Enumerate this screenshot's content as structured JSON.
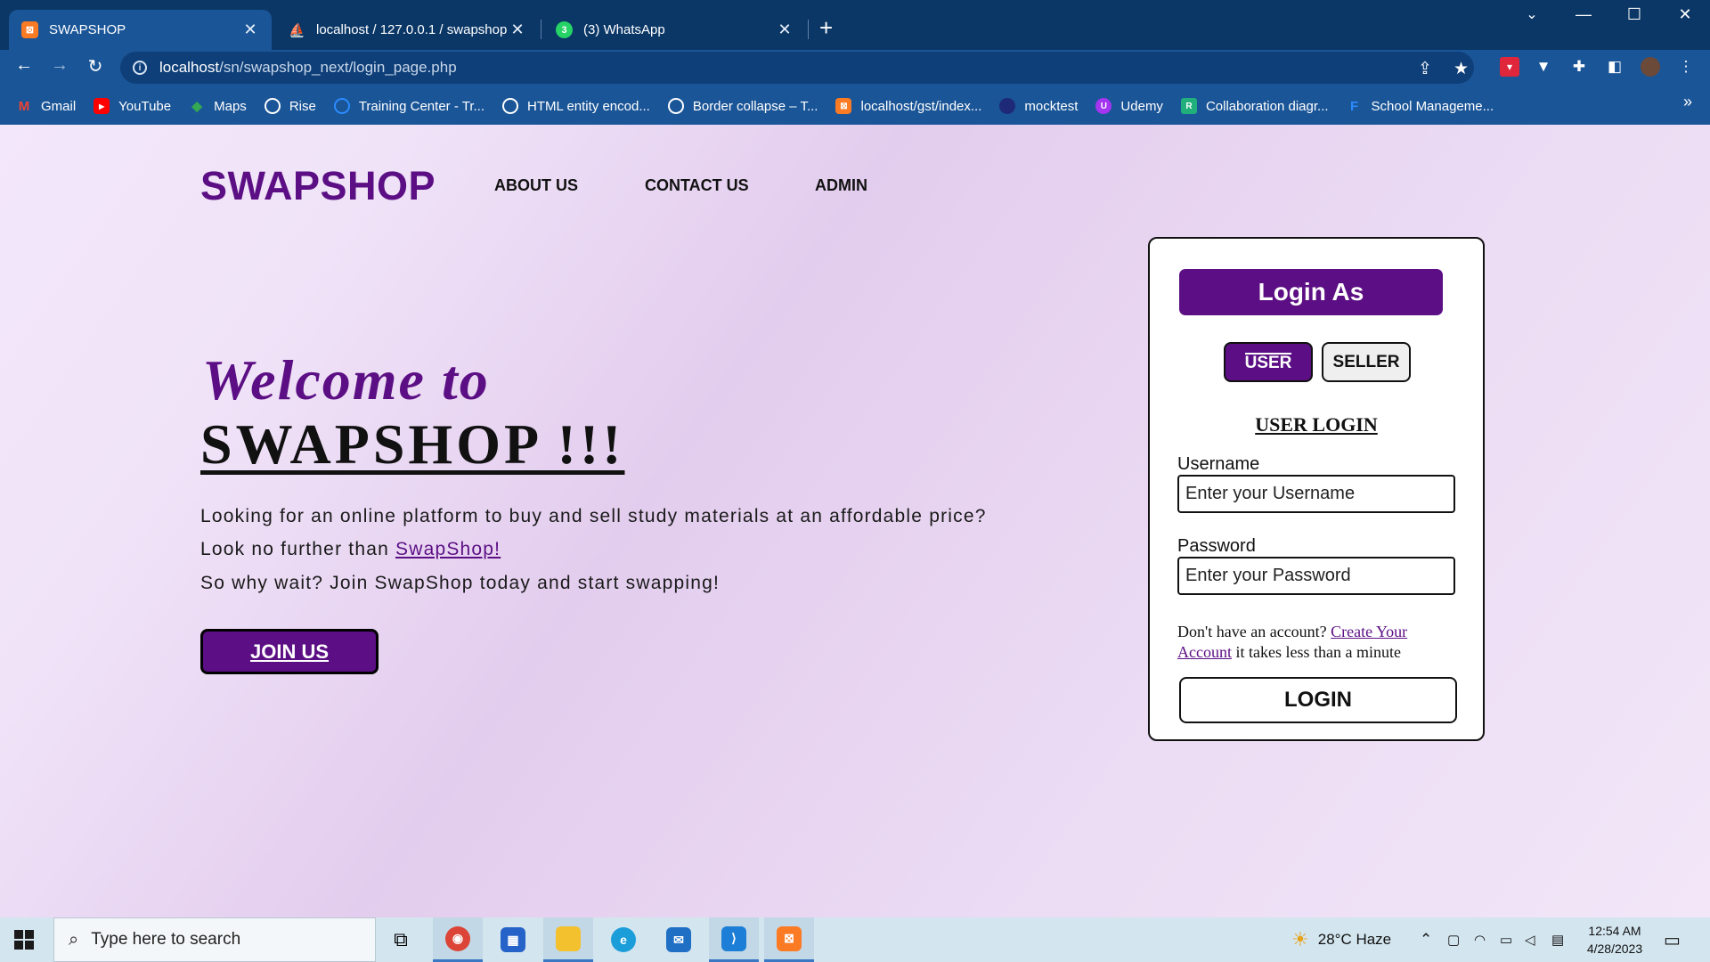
{
  "browser": {
    "tabs": [
      {
        "title": "SWAPSHOP",
        "icon": "xampp-icon",
        "active": true
      },
      {
        "title": "localhost / 127.0.0.1 / swapshop",
        "icon": "phpmyadmin-icon",
        "active": false
      },
      {
        "title": "(3) WhatsApp",
        "icon": "whatsapp-icon",
        "active": false
      }
    ],
    "url_host": "localhost",
    "url_path": "/sn/swapshop_next/login_page.php",
    "bookmarks": [
      {
        "label": "Gmail",
        "icon": "gmail-icon",
        "color": "#ea4335"
      },
      {
        "label": "YouTube",
        "icon": "youtube-icon",
        "color": "#ff0000"
      },
      {
        "label": "Maps",
        "icon": "maps-icon",
        "color": "#34a853"
      },
      {
        "label": "Rise",
        "icon": "globe-icon",
        "color": "#ffffff"
      },
      {
        "label": "Training Center - Tr...",
        "icon": "training-icon",
        "color": "#2b8cff"
      },
      {
        "label": "HTML entity encod...",
        "icon": "globe-icon",
        "color": "#ffffff"
      },
      {
        "label": "Border collapse – T...",
        "icon": "globe-icon",
        "color": "#ffffff"
      },
      {
        "label": "localhost/gst/index...",
        "icon": "xampp-icon",
        "color": "#fb7a24"
      },
      {
        "label": "mocktest",
        "icon": "mocktest-icon",
        "color": "#1e2a78"
      },
      {
        "label": "Udemy",
        "icon": "udemy-icon",
        "color": "#a435f0"
      },
      {
        "label": "Collaboration diagr...",
        "icon": "diagram-icon",
        "color": "#21b07c"
      },
      {
        "label": "School Manageme...",
        "icon": "school-icon",
        "color": "#1a6fe0"
      }
    ]
  },
  "site": {
    "brand": "SWAPSHOP",
    "nav": [
      "ABOUT US",
      "CONTACT US",
      "ADMIN"
    ],
    "welcome": "Welcome to",
    "title": "SWAPSHOP !!!",
    "line1": "Looking for an online platform to buy and sell study materials at an affordable price?",
    "line2_prefix": "Look no further than ",
    "line2_link": "SwapShop!",
    "line3": "So why wait? Join SwapShop today and start swapping!",
    "join_button": "JOIN US"
  },
  "login": {
    "header": "Login As",
    "role_user": "USER",
    "role_seller": "SELLER",
    "title": "USER LOGIN",
    "username_label": "Username",
    "username_placeholder": "Enter your Username",
    "password_label": "Password",
    "password_placeholder": "Enter your Password",
    "signup_prefix": "Don't have an account? ",
    "signup_link": "Create Your Account",
    "signup_suffix": " it takes less than a minute",
    "submit": "LOGIN"
  },
  "taskbar": {
    "search_placeholder": "Type here to search",
    "weather": "28°C  Haze",
    "time": "12:54 AM",
    "date": "4/28/2023"
  },
  "colors": {
    "brand_purple": "#5c0f84",
    "chrome_dark": "#0b3767",
    "chrome": "#1a5597"
  }
}
